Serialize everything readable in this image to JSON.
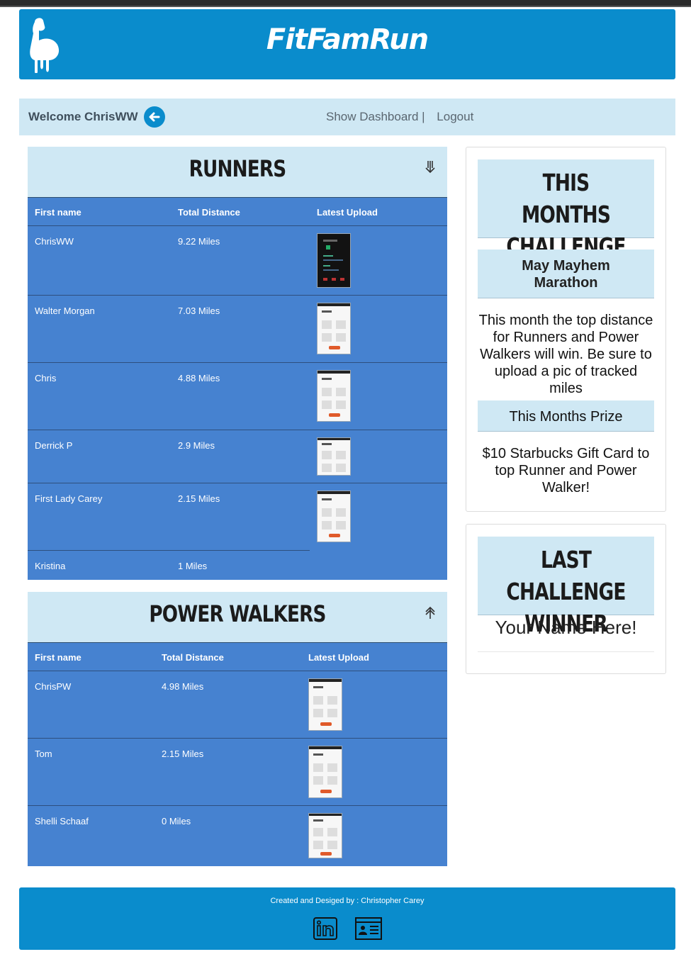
{
  "site": {
    "title": "FitFamRun"
  },
  "welcome": {
    "text": "Welcome ChrisWW",
    "show_dashboard": "Show Dashboard |",
    "logout": "Logout"
  },
  "runners": {
    "title": "RUNNERS",
    "columns": [
      "First name",
      "Total Distance",
      "Latest Upload"
    ],
    "rows": [
      {
        "name": "ChrisWW",
        "distance": "9.22 Miles"
      },
      {
        "name": "Walter Morgan",
        "distance": "7.03 Miles"
      },
      {
        "name": "Chris",
        "distance": "4.88 Miles"
      },
      {
        "name": "Derrick P",
        "distance": "2.9 Miles"
      },
      {
        "name": "First Lady Carey",
        "distance": "2.15 Miles"
      },
      {
        "name": "Kristina",
        "distance": "1 Miles"
      }
    ]
  },
  "walkers": {
    "title": "POWER WALKERS",
    "columns": [
      "First name",
      "Total Distance",
      "Latest Upload"
    ],
    "rows": [
      {
        "name": "ChrisPW",
        "distance": "4.98 Miles"
      },
      {
        "name": "Tom",
        "distance": "2.15 Miles"
      },
      {
        "name": "Shelli Schaaf",
        "distance": "0 Miles"
      }
    ]
  },
  "challenge": {
    "title_line1": "THIS MONTHS",
    "title_line2": "CHALLENGE",
    "name_line1": "May Mayhem",
    "name_line2": "Marathon",
    "description": "This month the top distance for Runners and Power Walkers will win. Be sure to upload a pic of tracked miles",
    "prize_title": "This Months Prize",
    "prize": "$10 Starbucks Gift Card to top Runner and Power Walker!"
  },
  "last_winner": {
    "title_line1": "LAST CHALLENGE",
    "title_line2": "WINNER",
    "name": "Your Name Here!"
  },
  "footer": {
    "credit": "Created and Desiged by : Christopher Carey"
  },
  "colors": {
    "brand_blue": "#0a8ccc",
    "table_blue": "#4682d0",
    "light_blue": "#cfe8f4"
  },
  "icons": [
    "flexed-arm-logo-icon",
    "arrow-left-icon",
    "sort-down-icon",
    "sort-up-icon",
    "linkedin-icon",
    "resume-icon"
  ]
}
